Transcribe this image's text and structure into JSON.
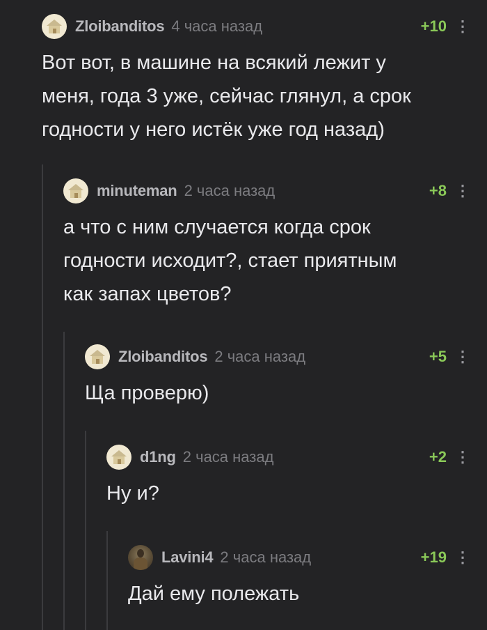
{
  "comments": [
    {
      "author": "Zloibanditos",
      "time": "4 часа назад",
      "rating": "+10",
      "avatar": "house-avatar",
      "text": [
        "Вот вот, в машине на всякий лежит у",
        "меня, года 3 уже, сейчас глянул, а срок",
        "годности у него истёк уже год назад)"
      ]
    },
    {
      "author": "minuteman",
      "time": "2 часа назад",
      "rating": "+8",
      "avatar": "house-avatar",
      "text": [
        "а что с ним случается когда срок",
        "годности исходит?, стает приятным",
        "как запах цветов?"
      ]
    },
    {
      "author": "Zloibanditos",
      "time": "2 часа назад",
      "rating": "+5",
      "avatar": "house-avatar",
      "text": [
        "Ща проверю)"
      ]
    },
    {
      "author": "d1ng",
      "time": "2 часа назад",
      "rating": "+2",
      "avatar": "house-avatar",
      "text": [
        "Ну и?"
      ]
    },
    {
      "author": "Lavini4",
      "time": "2 часа назад",
      "rating": "+19",
      "avatar": "photo-avatar",
      "text": [
        "Дай ему полежать"
      ]
    }
  ],
  "menu_glyph": "⋮",
  "colors": {
    "background": "#232325",
    "rating": "#8ac858",
    "thread_line": "#3b3b3e"
  }
}
